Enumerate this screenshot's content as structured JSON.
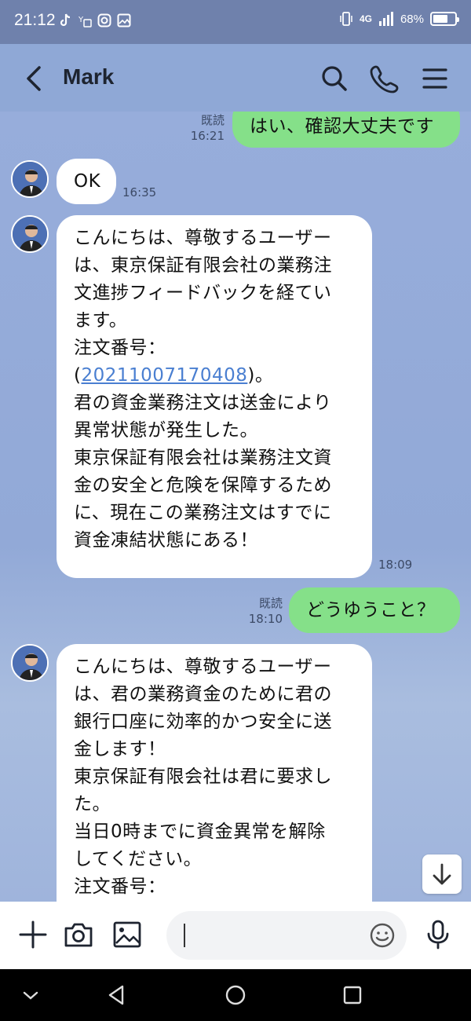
{
  "status": {
    "time": "21:12",
    "signal": "4G",
    "battery": "68%",
    "battery_level": 0.68
  },
  "header": {
    "contact_name": "Mark"
  },
  "messages": {
    "m1": {
      "text": "はい、確認大丈夫です",
      "read": "既読",
      "time": "16:21"
    },
    "m2": {
      "text": "OK",
      "time": "16:35"
    },
    "m3": {
      "line1": "こんにちは、尊敬するユーザー\nは、東京保証有限会社の業務注\n文進捗フィードバックを経てい\nます。\n注文番号：\n(",
      "order": "20211007170408",
      "line2": ")。\n君の資金業務注文は送金により\n異常状態が発生した。\n東京保証有限会社は業務注文資\n金の安全と危険を保障するため\nに、現在この業務注文はすでに\n資金凍結状態にある！",
      "time": "18:09"
    },
    "m4": {
      "text": "どうゆうこと？",
      "read": "既読",
      "time": "18:10"
    },
    "m5": {
      "text": "こんにちは、尊敬するユーザー\nは、君の業務資金のために君の\n銀行口座に効率的かつ安全に送\n金します！\n東京保証有限会社は君に要求し\nた。\n当日0時までに資金異常を解除\nしてください。\n注文番号："
    }
  },
  "colors": {
    "outgoing_bubble": "#85e089",
    "incoming_bubble": "#ffffff",
    "background": "#8fa8d6",
    "link": "#4a7fd1"
  }
}
